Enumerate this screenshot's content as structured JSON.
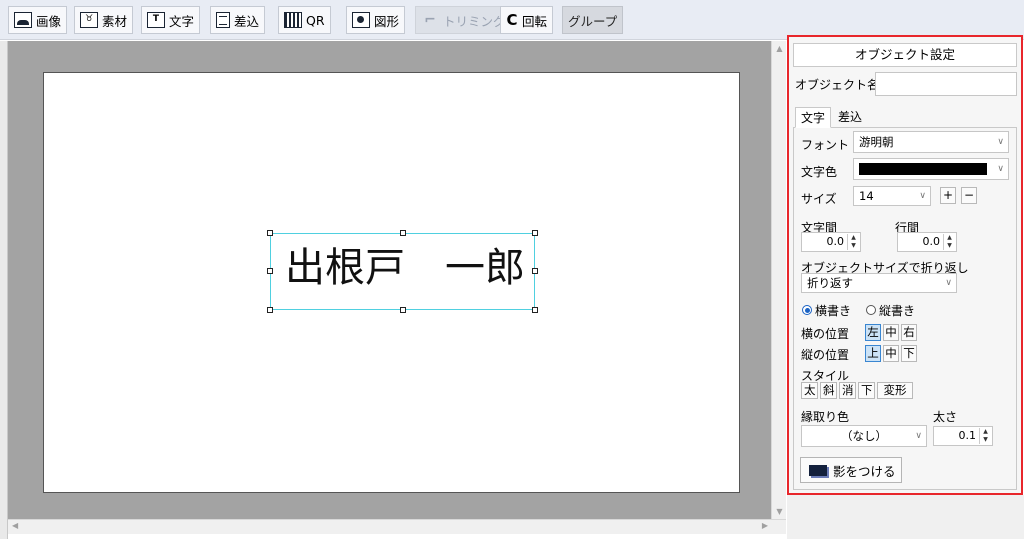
{
  "toolbar": {
    "image": "画像",
    "material": "素材",
    "text": "文字",
    "merge": "差込",
    "qr": "QR",
    "shape": "図形",
    "trim": "トリミング",
    "rotate": "回転",
    "group": "グループ",
    "text_icon_glyph": "T",
    "material_icon_glyph": "♉",
    "rotate_icon_glyph": "C",
    "crop_icon_glyph": "⌐"
  },
  "canvas": {
    "text_object": "出根戸　一郎"
  },
  "panel": {
    "title": "オブジェクト設定",
    "object_name_label": "オブジェクト名",
    "object_name_value": "",
    "tabs": [
      "文字",
      "差込"
    ],
    "font_label": "フォント",
    "font_value": "游明朝",
    "color_label": "文字色",
    "text_color": "#000000",
    "size_label": "サイズ",
    "size_value": "14",
    "plus": "+",
    "minus": "−",
    "char_spacing_label": "文字間",
    "char_spacing_value": "0.0",
    "line_spacing_label": "行間",
    "line_spacing_value": "0.0",
    "wrap_label": "オブジェクトサイズで折り返し",
    "wrap_value": "折り返す",
    "horizontal_writing": "横書き",
    "vertical_writing": "縦書き",
    "h_pos_label": "横の位置",
    "h_pos_options": [
      "左",
      "中",
      "右"
    ],
    "v_pos_label": "縦の位置",
    "v_pos_options": [
      "上",
      "中",
      "下"
    ],
    "style_label": "スタイル",
    "style_options": [
      "太",
      "斜",
      "消",
      "下",
      "変形"
    ],
    "outline_color_label": "縁取り色",
    "outline_color_value": "（なし）",
    "thickness_label": "太さ",
    "thickness_value": "0.1",
    "shadow_button": "影をつける"
  },
  "colors": {
    "highlight_border": "#e8262b",
    "selection_frame": "#4fd0e0",
    "canvas_background": "#a3a3a3"
  }
}
